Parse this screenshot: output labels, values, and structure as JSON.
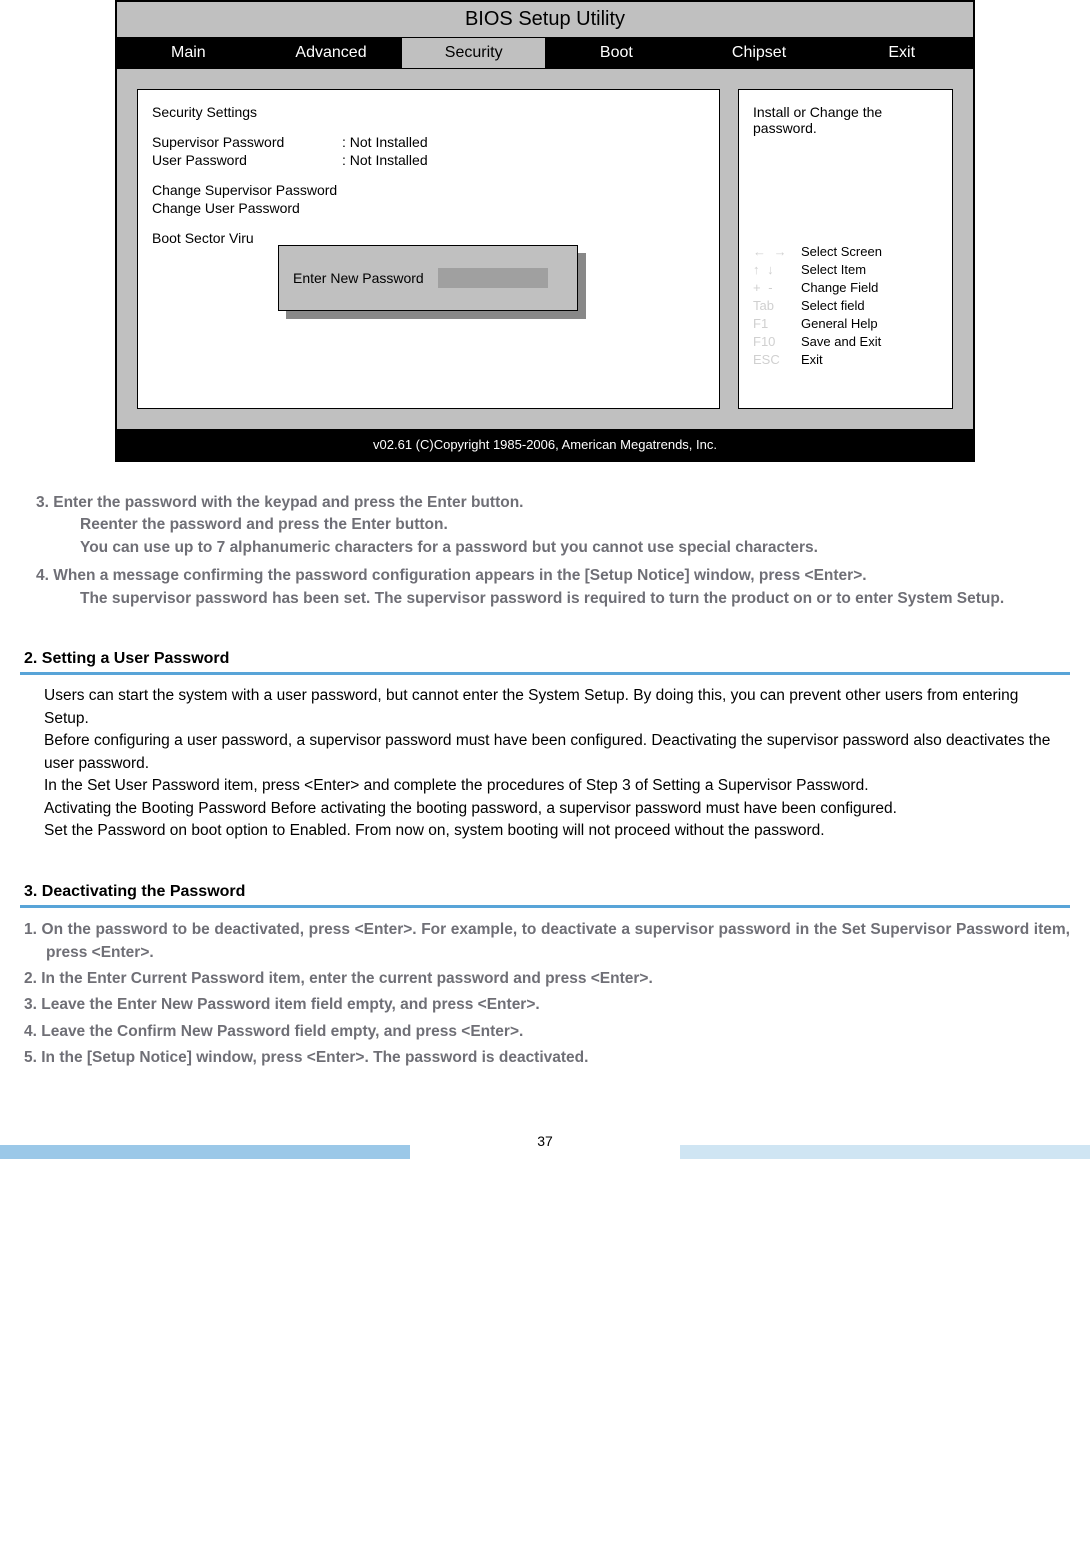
{
  "bios": {
    "title": "BIOS Setup Utility",
    "menu": [
      "Main",
      "Advanced",
      "Security",
      "Boot",
      "Chipset",
      "Exit"
    ],
    "active_menu": "Security",
    "left": {
      "heading": "Security Settings",
      "supervisor_label": "Supervisor Password",
      "supervisor_value": ": Not Installed",
      "user_label": "User Password",
      "user_value": ": Not Installed",
      "change_sup": "Change Supervisor Password",
      "change_user": "Change User Password",
      "boot_sector": "Boot Sector Viru"
    },
    "right": {
      "top_line1": "Install or Change the",
      "top_line2": "password.",
      "help": [
        {
          "key_class": "arrow-h",
          "key": "",
          "text": "Select Screen"
        },
        {
          "key_class": "arrow-v",
          "key": "",
          "text": "Select Item"
        },
        {
          "key_class": "plusminus",
          "key": "",
          "text": "Change Field"
        },
        {
          "key_class": "",
          "key": "Tab",
          "text": "Select field"
        },
        {
          "key_class": "",
          "key": "F1",
          "text": "General Help"
        },
        {
          "key_class": "",
          "key": "F10",
          "text": "Save and Exit"
        },
        {
          "key_class": "",
          "key": "ESC",
          "text": "Exit"
        }
      ]
    },
    "dialog_label": "Enter New Password",
    "footer": "v02.61    (C)Copyright 1985-2006, American Megatrends, Inc."
  },
  "steps_a": {
    "s3_line1": "3. Enter the password with the keypad and press the Enter button.",
    "s3_line2": "Reenter the password and press the Enter button.",
    "s3_line3": "You can use up to 7 alphanumeric characters for a password but you cannot use special characters.",
    "s4_line1": "4. When a message confirming the password configuration appears in the [Setup Notice] window, press <Enter>.",
    "s4_line2": "The supervisor password has been set. The supervisor password is required to turn the product on or to enter System Setup."
  },
  "section2": {
    "heading": "2. Setting a User Password",
    "p1": "Users can start the system with a user password, but cannot enter the System Setup. By doing this, you can prevent other users from entering Setup.",
    "p2": "Before configuring a user password, a supervisor password must have been configured. Deactivating the supervisor password also deactivates the user password.",
    "p3": "In the Set User Password item, press <Enter> and complete the procedures of Step 3 of Setting a Supervisor Password.",
    "p4": "Activating the Booting Password Before activating the booting password, a supervisor password must have been configured.",
    "p5": "Set the Password on boot option to Enabled. From now on, system booting will not proceed without the password."
  },
  "section3": {
    "heading": "3. Deactivating the Password",
    "s1": "1. On the password to be deactivated, press <Enter>. For example, to deactivate a supervisor password in the Set Supervisor Password item, press <Enter>.",
    "s2": "2. In the Enter Current Password item, enter the current password and press <Enter>.",
    "s3": "3. Leave the Enter New Password item field empty, and press <Enter>.",
    "s4": "4. Leave the Confirm New Password field empty, and press <Enter>.",
    "s5": "5. In the [Setup Notice] window, press <Enter>. The password is deactivated."
  },
  "page_number": "37"
}
